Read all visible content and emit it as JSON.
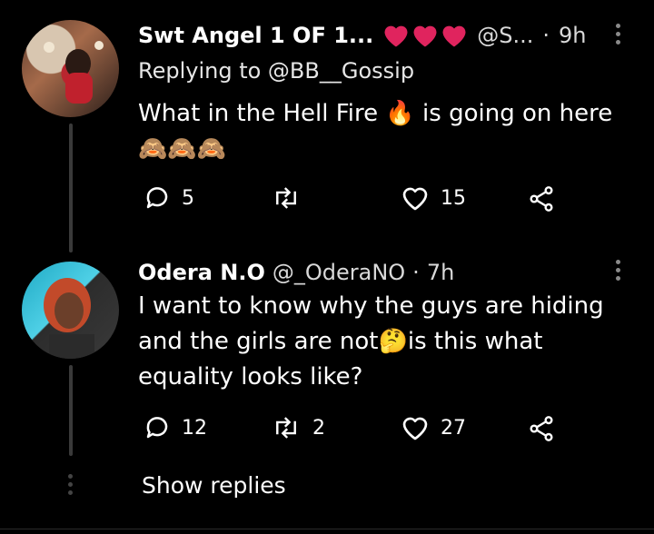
{
  "tweets": [
    {
      "display_name": "Swt Angel 1 OF 1...",
      "name_hearts": [
        "red-heart",
        "red-heart",
        "red-heart"
      ],
      "handle": "@S...",
      "separator": "·",
      "time": "9h",
      "replying_to": "Replying to @BB__Gossip",
      "text_line1_a": "What in the Hell Fire ",
      "text_line1_emoji": "🔥",
      "text_line1_b": " is going on here",
      "text_line2": "🙈🙈🙈",
      "replies": "5",
      "retweets": "",
      "likes": "15"
    },
    {
      "display_name": "Odera N.O",
      "handle": "@_OderaNO",
      "separator": "·",
      "time": "7h",
      "text_line1": "I want to know why the guys are hiding",
      "text_line2_a": "and the girls are not",
      "text_line2_emoji": "🤔",
      "text_line2_b": "is this what",
      "text_line3": "equality looks like?",
      "replies": "12",
      "retweets": "2",
      "likes": "27"
    }
  ],
  "show_replies": "Show replies",
  "colors": {
    "background": "#000000",
    "thread_line": "#3a3a3a",
    "heart": "#e0245e",
    "icon": "#ffffff"
  }
}
